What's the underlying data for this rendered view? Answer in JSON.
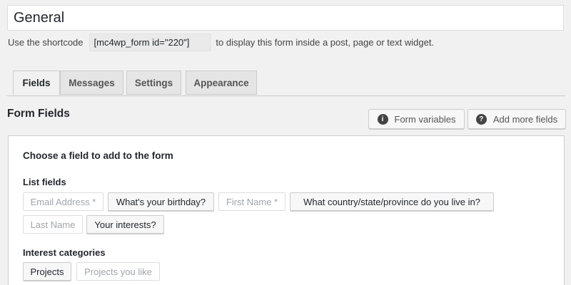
{
  "form": {
    "title_value": "General"
  },
  "shortcode": {
    "prefix": "Use the shortcode",
    "code": "[mc4wp_form id=\"220\"]",
    "suffix": "to display this form inside a post, page or text widget."
  },
  "tabs": [
    {
      "label": "Fields",
      "active": true
    },
    {
      "label": "Messages",
      "active": false
    },
    {
      "label": "Settings",
      "active": false
    },
    {
      "label": "Appearance",
      "active": false
    }
  ],
  "section": {
    "title": "Form Fields"
  },
  "toolbar": {
    "form_variables_label": "Form variables",
    "add_more_fields_label": "Add more fields",
    "info_icon": "info-icon",
    "help_icon": "help-icon"
  },
  "panel": {
    "heading": "Choose a field to add to the form",
    "list_fields_label": "List fields",
    "list_fields": [
      {
        "label": "Email Address *",
        "disabled": true
      },
      {
        "label": "What's your birthday?",
        "disabled": false
      },
      {
        "label": "First Name *",
        "disabled": true
      },
      {
        "label": "What country/state/province do you live in?",
        "disabled": false
      },
      {
        "label": "Last Name",
        "disabled": true
      },
      {
        "label": "Your interests?",
        "disabled": false
      }
    ],
    "interest_categories_label": "Interest categories",
    "interest_categories": [
      {
        "label": "Projects",
        "disabled": false
      },
      {
        "label": "Projects you like",
        "disabled": true
      }
    ]
  }
}
